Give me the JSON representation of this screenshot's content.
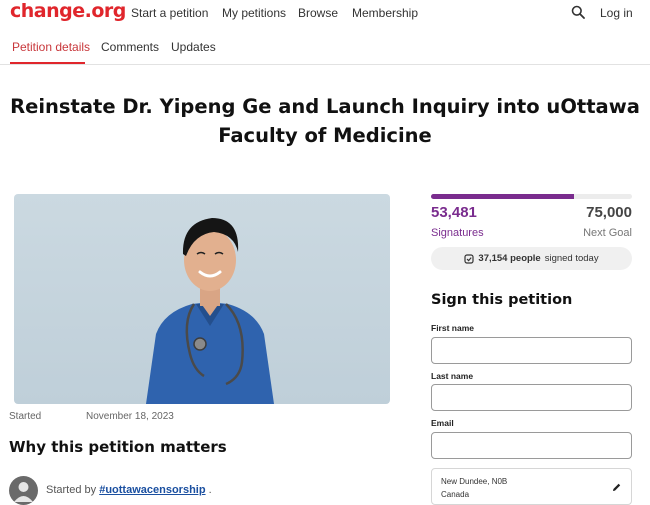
{
  "brand": {
    "logo": "change.org"
  },
  "nav": {
    "items": [
      "Start a petition",
      "My petitions",
      "Browse",
      "Membership"
    ],
    "search_icon": "search-icon",
    "login": "Log in"
  },
  "tabs": [
    "Petition details",
    "Comments",
    "Updates"
  ],
  "petition": {
    "title_line1": "Reinstate Dr. Yipeng Ge and Launch Inquiry into uOttawa",
    "title_line2": "Faculty of Medicine",
    "started_label": "Started",
    "started_date": "November 18, 2023",
    "why_heading": "Why this petition matters",
    "started_by_prefix": "Started by",
    "started_by_name": "#uottawacensorship",
    "started_by_suffix": "."
  },
  "stats": {
    "signatures": "53,481",
    "signatures_label": "Signatures",
    "goal": "75,000",
    "goal_label": "Next Goal",
    "progress_fraction": 0.713,
    "today_count": "37,154 people",
    "today_suffix": "signed today"
  },
  "sign_form": {
    "heading": "Sign this petition",
    "first_name_label": "First name",
    "last_name_label": "Last name",
    "email_label": "Email",
    "location_line1": "New Dundee, N0B",
    "location_line2": "Canada"
  },
  "colors": {
    "brand_red": "#e0262c",
    "accent_purple": "#7a2c8e",
    "link_blue": "#1a4fa0"
  }
}
